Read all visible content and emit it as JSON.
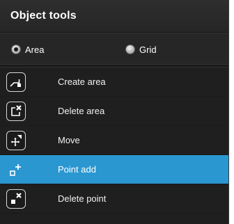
{
  "header": {
    "title": "Object tools"
  },
  "mode": {
    "options": [
      {
        "label": "Area",
        "checked": true
      },
      {
        "label": "Grid",
        "checked": false
      }
    ]
  },
  "tools": [
    {
      "label": "Create area",
      "icon": "create-area-icon",
      "active": false
    },
    {
      "label": "Delete area",
      "icon": "delete-area-icon",
      "active": false
    },
    {
      "label": "Move",
      "icon": "move-icon",
      "active": false
    },
    {
      "label": "Point add",
      "icon": "point-add-icon",
      "active": true
    },
    {
      "label": "Delete point",
      "icon": "delete-point-icon",
      "active": false
    }
  ],
  "colors": {
    "panel_bg": "#1f1f1f",
    "active_row": "#2b97d1",
    "text": "#ffffff"
  }
}
